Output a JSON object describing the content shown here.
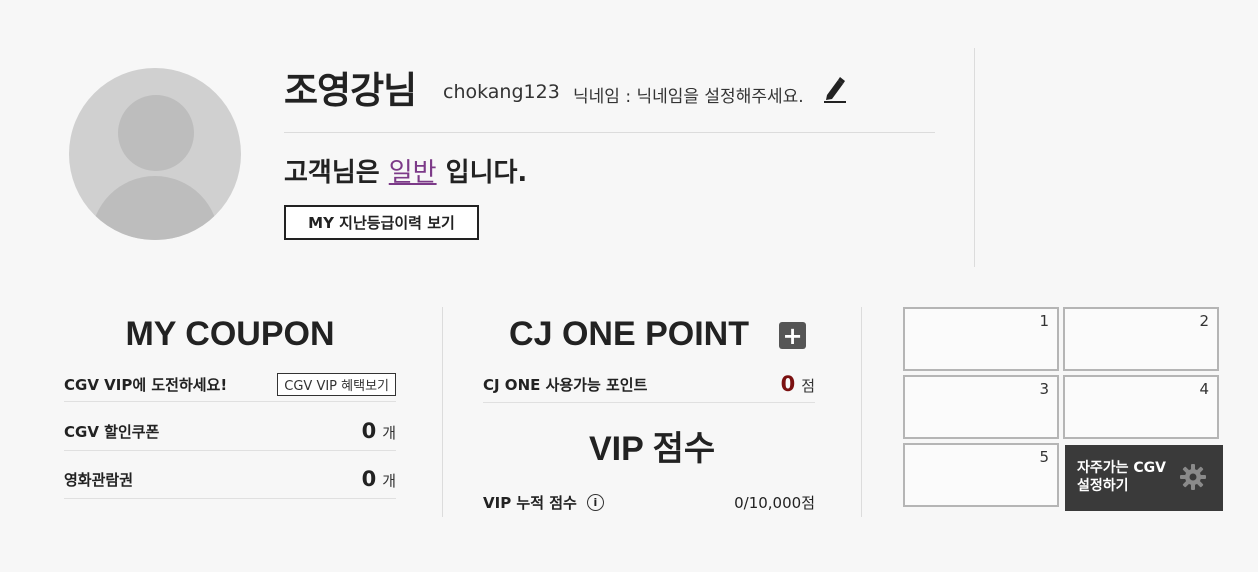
{
  "profile": {
    "name": "조영강님",
    "user_id": "chokang123",
    "nickname_text": "닉네임 : 닉네임을 설정해주세요.",
    "grade_prefix": "고객님은",
    "grade": "일반",
    "grade_suffix": "입니다.",
    "history_button": "MY 지난등급이력 보기"
  },
  "coupon": {
    "title": "MY COUPON",
    "vip_challenge_label": "CGV VIP에 도전하세요!",
    "vip_benefit_button": "CGV VIP 혜택보기",
    "discount_label": "CGV 할인쿠폰",
    "discount_count": "0",
    "discount_unit": "개",
    "ticket_label": "영화관람권",
    "ticket_count": "0",
    "ticket_unit": "개"
  },
  "cjone": {
    "title": "CJ ONE POINT",
    "available_label": "CJ ONE 사용가능 포인트",
    "available_points": "0",
    "points_unit": "점",
    "vip_title": "VIP 점수",
    "vip_score_label": "VIP 누적 점수",
    "vip_score_value": "0/10,000점"
  },
  "favorites": {
    "slots": [
      "1",
      "2",
      "3",
      "4",
      "5"
    ],
    "setting_line1": "자주가는 CGV",
    "setting_line2": "설정하기"
  },
  "icons": {
    "edit": "pen-icon",
    "add": "plus-icon",
    "info": "info-icon",
    "settings": "gear-icon"
  },
  "colors": {
    "grade": "#7c3a88",
    "points": "#7a1010",
    "setting_bg": "#3a3a3a"
  }
}
